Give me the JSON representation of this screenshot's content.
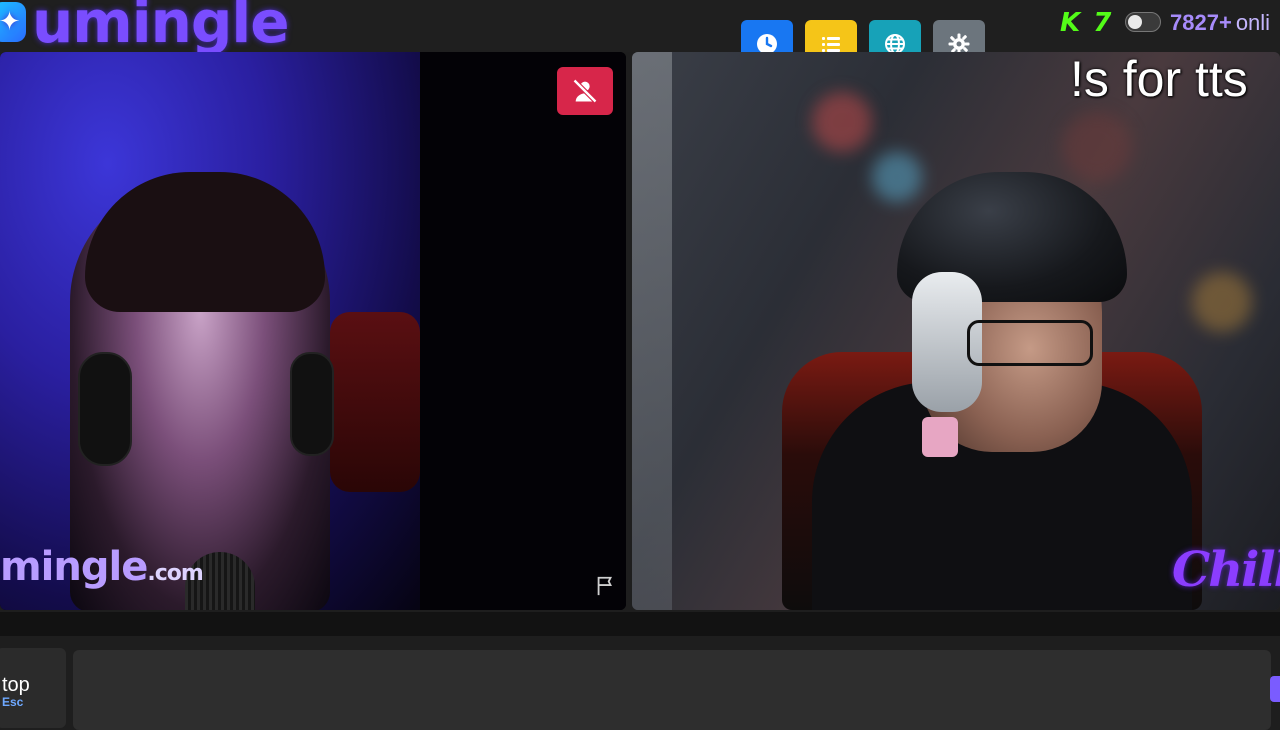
{
  "app": {
    "logo_text": "umingle",
    "logo_icon": "chat-bubble-logo-icon"
  },
  "toolbar": {
    "buttons": [
      {
        "name": "history",
        "icon": "clock-icon",
        "color": "#1877f2"
      },
      {
        "name": "list",
        "icon": "list-icon",
        "color": "#f5c518"
      },
      {
        "name": "language",
        "icon": "globe-icon",
        "color": "#17a2b8"
      },
      {
        "name": "settings",
        "icon": "gear-icon",
        "color": "#6c757d"
      }
    ]
  },
  "status": {
    "kick_badge": "K 7",
    "toggle_state": "off",
    "online_count": "7827",
    "online_plus": "+",
    "online_label": "onli"
  },
  "left_video": {
    "watermark": "mingle",
    "watermark_suffix": ".com",
    "mute_icon": "user-slash-icon",
    "mute_color": "#d7264a",
    "report_icon": "flag-icon"
  },
  "right_video": {
    "overlay_text": "!s for tts",
    "logo_text": "Chill"
  },
  "controls": {
    "stop_label": "top",
    "stop_shortcut": "Esc"
  }
}
